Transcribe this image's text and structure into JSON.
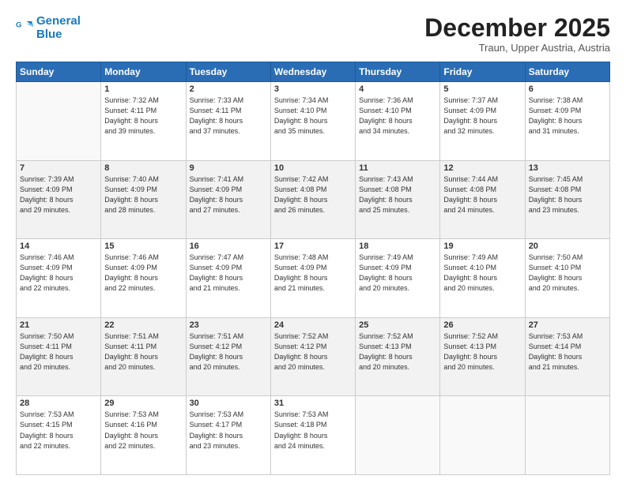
{
  "logo": {
    "line1": "General",
    "line2": "Blue"
  },
  "title": "December 2025",
  "location": "Traun, Upper Austria, Austria",
  "days_of_week": [
    "Sunday",
    "Monday",
    "Tuesday",
    "Wednesday",
    "Thursday",
    "Friday",
    "Saturday"
  ],
  "weeks": [
    [
      {
        "day": "",
        "info": ""
      },
      {
        "day": "1",
        "info": "Sunrise: 7:32 AM\nSunset: 4:11 PM\nDaylight: 8 hours\nand 39 minutes."
      },
      {
        "day": "2",
        "info": "Sunrise: 7:33 AM\nSunset: 4:11 PM\nDaylight: 8 hours\nand 37 minutes."
      },
      {
        "day": "3",
        "info": "Sunrise: 7:34 AM\nSunset: 4:10 PM\nDaylight: 8 hours\nand 35 minutes."
      },
      {
        "day": "4",
        "info": "Sunrise: 7:36 AM\nSunset: 4:10 PM\nDaylight: 8 hours\nand 34 minutes."
      },
      {
        "day": "5",
        "info": "Sunrise: 7:37 AM\nSunset: 4:09 PM\nDaylight: 8 hours\nand 32 minutes."
      },
      {
        "day": "6",
        "info": "Sunrise: 7:38 AM\nSunset: 4:09 PM\nDaylight: 8 hours\nand 31 minutes."
      }
    ],
    [
      {
        "day": "7",
        "info": "Sunrise: 7:39 AM\nSunset: 4:09 PM\nDaylight: 8 hours\nand 29 minutes."
      },
      {
        "day": "8",
        "info": "Sunrise: 7:40 AM\nSunset: 4:09 PM\nDaylight: 8 hours\nand 28 minutes."
      },
      {
        "day": "9",
        "info": "Sunrise: 7:41 AM\nSunset: 4:09 PM\nDaylight: 8 hours\nand 27 minutes."
      },
      {
        "day": "10",
        "info": "Sunrise: 7:42 AM\nSunset: 4:08 PM\nDaylight: 8 hours\nand 26 minutes."
      },
      {
        "day": "11",
        "info": "Sunrise: 7:43 AM\nSunset: 4:08 PM\nDaylight: 8 hours\nand 25 minutes."
      },
      {
        "day": "12",
        "info": "Sunrise: 7:44 AM\nSunset: 4:08 PM\nDaylight: 8 hours\nand 24 minutes."
      },
      {
        "day": "13",
        "info": "Sunrise: 7:45 AM\nSunset: 4:08 PM\nDaylight: 8 hours\nand 23 minutes."
      }
    ],
    [
      {
        "day": "14",
        "info": "Sunrise: 7:46 AM\nSunset: 4:09 PM\nDaylight: 8 hours\nand 22 minutes."
      },
      {
        "day": "15",
        "info": "Sunrise: 7:46 AM\nSunset: 4:09 PM\nDaylight: 8 hours\nand 22 minutes."
      },
      {
        "day": "16",
        "info": "Sunrise: 7:47 AM\nSunset: 4:09 PM\nDaylight: 8 hours\nand 21 minutes."
      },
      {
        "day": "17",
        "info": "Sunrise: 7:48 AM\nSunset: 4:09 PM\nDaylight: 8 hours\nand 21 minutes."
      },
      {
        "day": "18",
        "info": "Sunrise: 7:49 AM\nSunset: 4:09 PM\nDaylight: 8 hours\nand 20 minutes."
      },
      {
        "day": "19",
        "info": "Sunrise: 7:49 AM\nSunset: 4:10 PM\nDaylight: 8 hours\nand 20 minutes."
      },
      {
        "day": "20",
        "info": "Sunrise: 7:50 AM\nSunset: 4:10 PM\nDaylight: 8 hours\nand 20 minutes."
      }
    ],
    [
      {
        "day": "21",
        "info": "Sunrise: 7:50 AM\nSunset: 4:11 PM\nDaylight: 8 hours\nand 20 minutes."
      },
      {
        "day": "22",
        "info": "Sunrise: 7:51 AM\nSunset: 4:11 PM\nDaylight: 8 hours\nand 20 minutes."
      },
      {
        "day": "23",
        "info": "Sunrise: 7:51 AM\nSunset: 4:12 PM\nDaylight: 8 hours\nand 20 minutes."
      },
      {
        "day": "24",
        "info": "Sunrise: 7:52 AM\nSunset: 4:12 PM\nDaylight: 8 hours\nand 20 minutes."
      },
      {
        "day": "25",
        "info": "Sunrise: 7:52 AM\nSunset: 4:13 PM\nDaylight: 8 hours\nand 20 minutes."
      },
      {
        "day": "26",
        "info": "Sunrise: 7:52 AM\nSunset: 4:13 PM\nDaylight: 8 hours\nand 20 minutes."
      },
      {
        "day": "27",
        "info": "Sunrise: 7:53 AM\nSunset: 4:14 PM\nDaylight: 8 hours\nand 21 minutes."
      }
    ],
    [
      {
        "day": "28",
        "info": "Sunrise: 7:53 AM\nSunset: 4:15 PM\nDaylight: 8 hours\nand 22 minutes."
      },
      {
        "day": "29",
        "info": "Sunrise: 7:53 AM\nSunset: 4:16 PM\nDaylight: 8 hours\nand 22 minutes."
      },
      {
        "day": "30",
        "info": "Sunrise: 7:53 AM\nSunset: 4:17 PM\nDaylight: 8 hours\nand 23 minutes."
      },
      {
        "day": "31",
        "info": "Sunrise: 7:53 AM\nSunset: 4:18 PM\nDaylight: 8 hours\nand 24 minutes."
      },
      {
        "day": "",
        "info": ""
      },
      {
        "day": "",
        "info": ""
      },
      {
        "day": "",
        "info": ""
      }
    ]
  ]
}
